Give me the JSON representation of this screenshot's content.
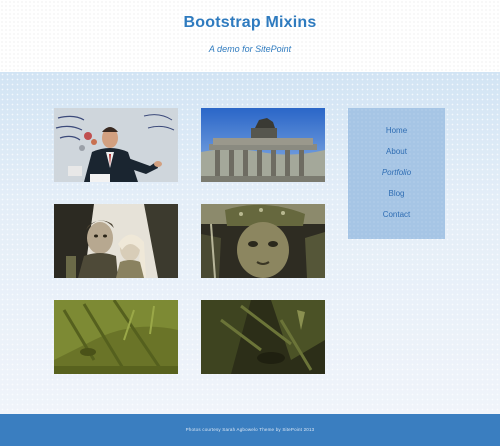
{
  "header": {
    "title": "Bootstrap Mixins",
    "tagline": "A demo for SitePoint"
  },
  "gallery": {
    "images": [
      {
        "name": "photo-man-speaking"
      },
      {
        "name": "photo-brandenburg-gate"
      },
      {
        "name": "photo-two-people"
      },
      {
        "name": "photo-soldier-portrait"
      },
      {
        "name": "photo-green-abstract"
      },
      {
        "name": "photo-dark-green-abstract"
      }
    ]
  },
  "sidebar": {
    "items": [
      {
        "label": "Home"
      },
      {
        "label": "About"
      },
      {
        "label": "Portfolio"
      },
      {
        "label": "Blog"
      },
      {
        "label": "Contact"
      }
    ]
  },
  "footer": {
    "text": "Photos courtesy Sarah Agbowelo     Theme by SitePoint     2013"
  },
  "colors": {
    "accent": "#2f7bbf",
    "sidebar_bg": "#a6c5e5",
    "footer_bg": "#3a7ec0"
  }
}
